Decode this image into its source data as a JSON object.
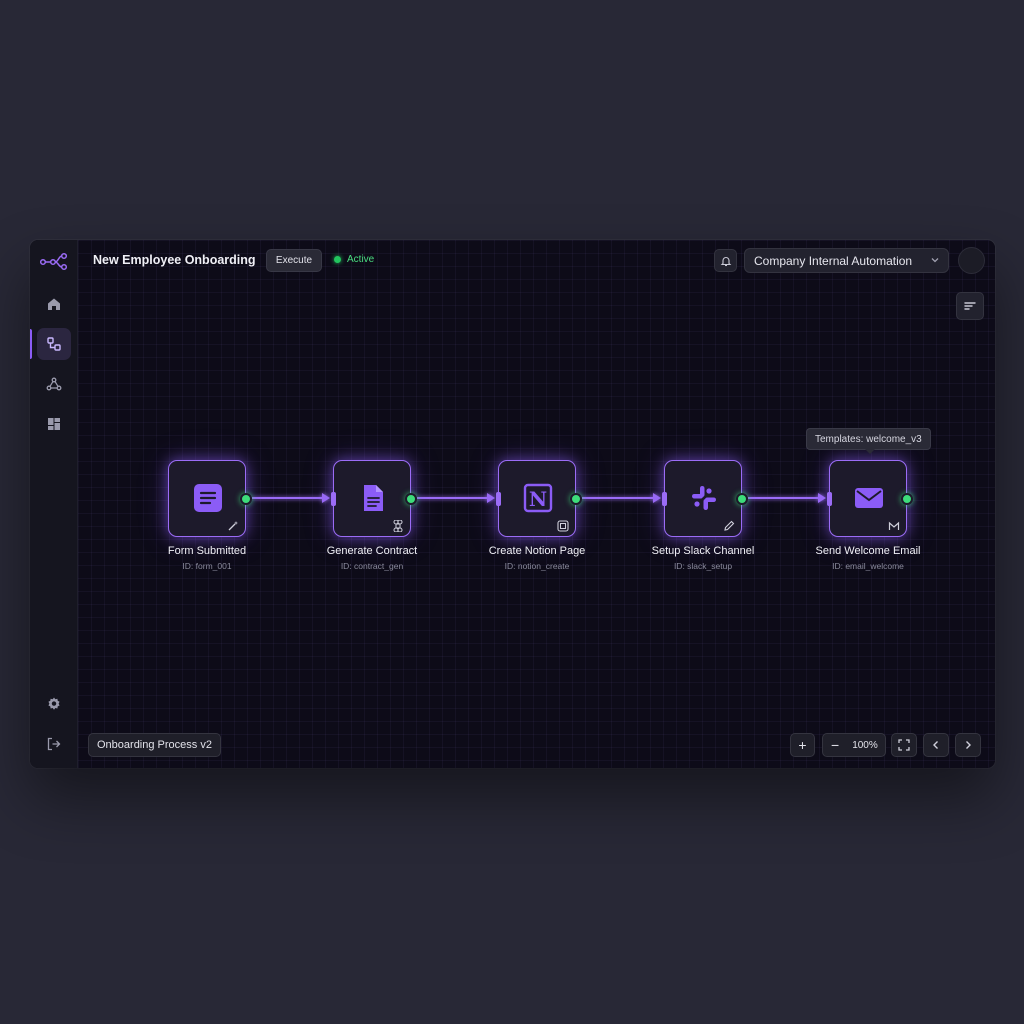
{
  "app": {
    "title": "New Employee Onboarding",
    "execute_label": "Execute",
    "status_label": "Active",
    "workspace": "Company Internal Automation",
    "version": "Onboarding Process v2",
    "accent": "#8b5cf6",
    "status_color": "#22c55e"
  },
  "sidebar": {
    "items": [
      {
        "icon": "logo-workflow-icon"
      },
      {
        "icon": "home-icon"
      },
      {
        "icon": "workflow-icon",
        "active": true
      },
      {
        "icon": "hierarchy-icon"
      },
      {
        "icon": "dashboard-icon"
      },
      {
        "icon": "gear-icon"
      },
      {
        "icon": "logout-icon"
      }
    ]
  },
  "nodes": [
    {
      "label": "Form Submitted",
      "id": "ID: form_001",
      "icon": "form-icon",
      "badge": "wand-icon"
    },
    {
      "label": "Generate Contract",
      "id": "ID: contract_gen",
      "icon": "document-icon",
      "badge": "command-icon"
    },
    {
      "label": "Create Notion Page",
      "id": "ID: notion_create",
      "icon": "notion-icon",
      "badge": "notion-small-icon"
    },
    {
      "label": "Setup Slack Channel",
      "id": "ID: slack_setup",
      "icon": "slack-icon",
      "badge": "pencil-icon"
    },
    {
      "label": "Send Welcome Email",
      "id": "ID: email_welcome",
      "icon": "mail-icon",
      "badge": "gmail-icon"
    }
  ],
  "tooltip": "Templates: welcome_v3",
  "zoom": {
    "level": "100%",
    "zoom_in": "+",
    "zoom_out": "−"
  }
}
